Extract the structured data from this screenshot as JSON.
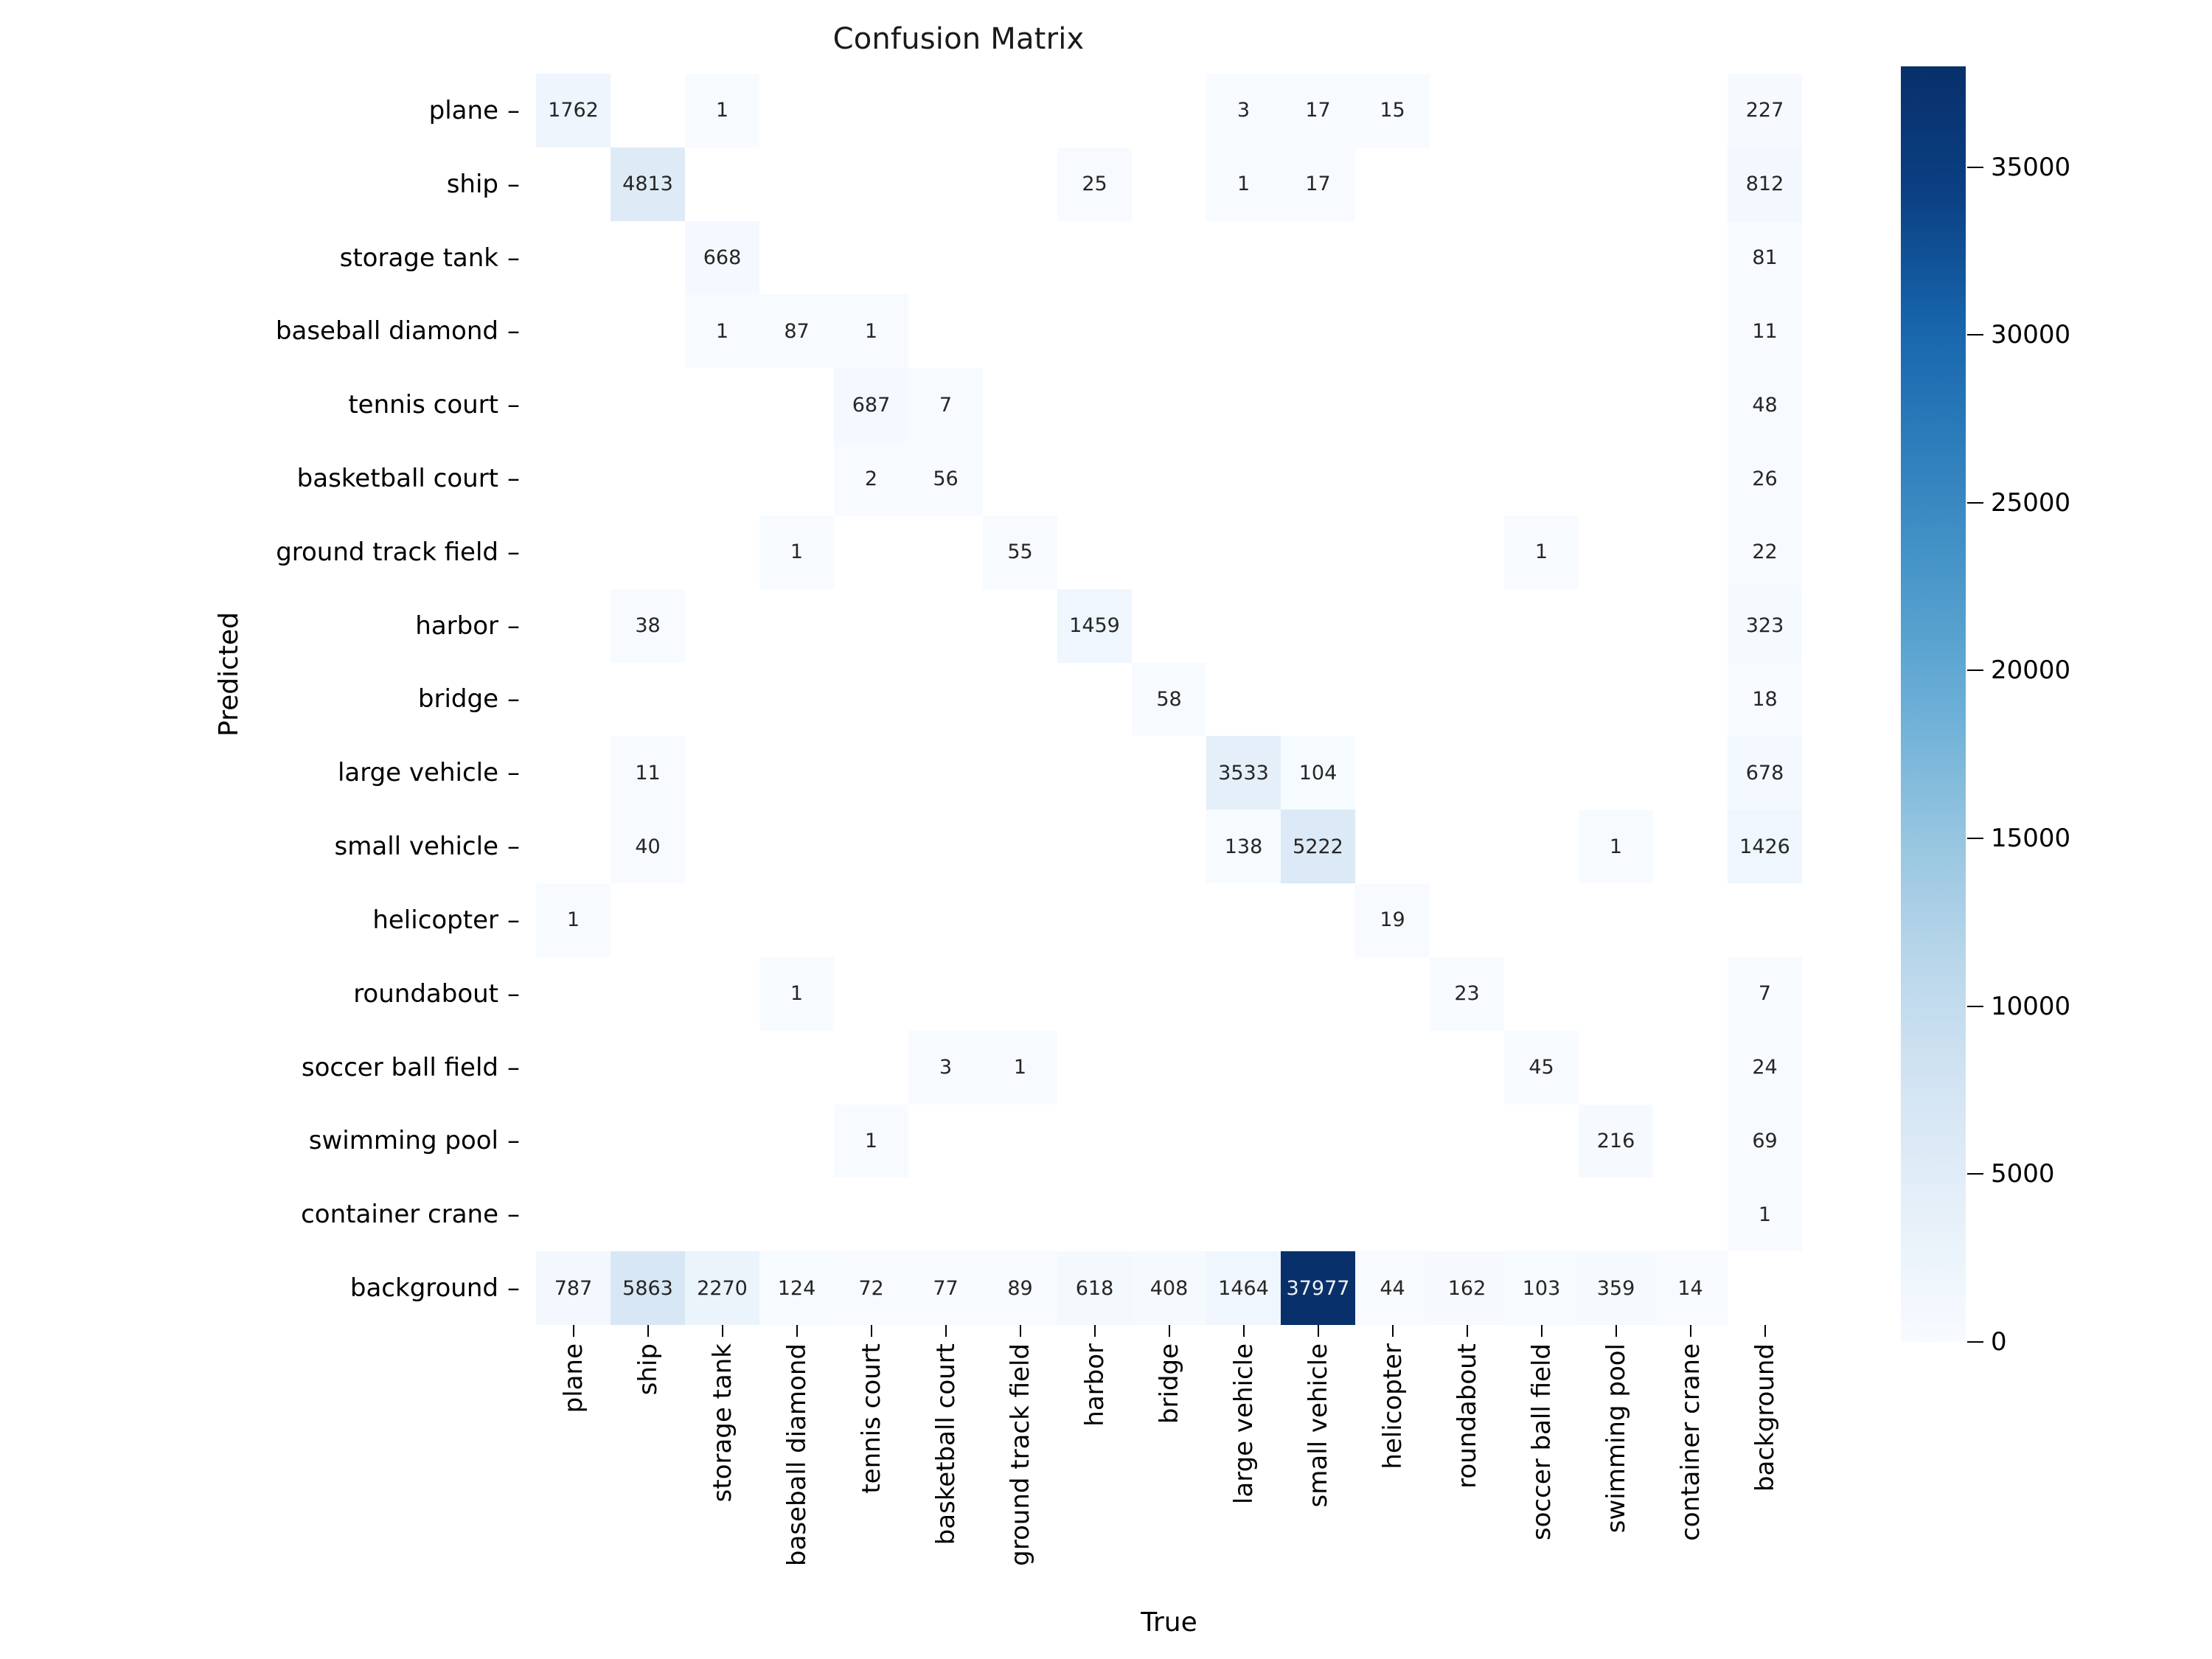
{
  "chart_data": {
    "type": "heatmap",
    "title": "Confusion Matrix",
    "xlabel": "True",
    "ylabel": "Predicted",
    "colormap": "Blues",
    "grid": false,
    "legend_position": "right-colorbar",
    "colorbar": {
      "min": 0,
      "max": 37977,
      "ticks": [
        0,
        5000,
        10000,
        15000,
        20000,
        25000,
        30000,
        35000
      ],
      "tick_labels": [
        "0",
        "5000",
        "10000",
        "15000",
        "20000",
        "25000",
        "30000",
        "35000"
      ],
      "low_color": "#f7fbff",
      "high_color": "#08306b"
    },
    "x_categories": [
      "plane",
      "ship",
      "storage tank",
      "baseball diamond",
      "tennis court",
      "basketball court",
      "ground track field",
      "harbor",
      "bridge",
      "large vehicle",
      "small vehicle",
      "helicopter",
      "roundabout",
      "soccer ball field",
      "swimming pool",
      "container crane",
      "background"
    ],
    "y_categories": [
      "plane",
      "ship",
      "storage tank",
      "baseball diamond",
      "tennis court",
      "basketball court",
      "ground track field",
      "harbor",
      "bridge",
      "large vehicle",
      "small vehicle",
      "helicopter",
      "roundabout",
      "soccer ball field",
      "swimming pool",
      "container crane",
      "background"
    ],
    "values": [
      [
        1762,
        null,
        1,
        null,
        null,
        null,
        null,
        null,
        null,
        3,
        17,
        15,
        null,
        null,
        null,
        null,
        227
      ],
      [
        null,
        4813,
        null,
        null,
        null,
        null,
        null,
        25,
        null,
        1,
        17,
        null,
        null,
        null,
        null,
        null,
        812
      ],
      [
        null,
        null,
        668,
        null,
        null,
        null,
        null,
        null,
        null,
        null,
        null,
        null,
        null,
        null,
        null,
        null,
        81
      ],
      [
        null,
        null,
        1,
        87,
        1,
        null,
        null,
        null,
        null,
        null,
        null,
        null,
        null,
        null,
        null,
        null,
        11
      ],
      [
        null,
        null,
        null,
        null,
        687,
        7,
        null,
        null,
        null,
        null,
        null,
        null,
        null,
        null,
        null,
        null,
        48
      ],
      [
        null,
        null,
        null,
        null,
        2,
        56,
        null,
        null,
        null,
        null,
        null,
        null,
        null,
        null,
        null,
        null,
        26
      ],
      [
        null,
        null,
        null,
        1,
        null,
        null,
        55,
        null,
        null,
        null,
        null,
        null,
        null,
        1,
        null,
        null,
        22
      ],
      [
        null,
        38,
        null,
        null,
        null,
        null,
        null,
        1459,
        null,
        null,
        null,
        null,
        null,
        null,
        null,
        null,
        323
      ],
      [
        null,
        null,
        null,
        null,
        null,
        null,
        null,
        null,
        58,
        null,
        null,
        null,
        null,
        null,
        null,
        null,
        18
      ],
      [
        null,
        11,
        null,
        null,
        null,
        null,
        null,
        null,
        null,
        3533,
        104,
        null,
        null,
        null,
        null,
        null,
        678
      ],
      [
        null,
        40,
        null,
        null,
        null,
        null,
        null,
        null,
        null,
        138,
        5222,
        null,
        null,
        null,
        1,
        null,
        1426
      ],
      [
        1,
        null,
        null,
        null,
        null,
        null,
        null,
        null,
        null,
        null,
        null,
        19,
        null,
        null,
        null,
        null,
        null
      ],
      [
        null,
        null,
        null,
        1,
        null,
        null,
        null,
        null,
        null,
        null,
        null,
        null,
        23,
        null,
        null,
        null,
        7
      ],
      [
        null,
        null,
        null,
        null,
        null,
        3,
        1,
        null,
        null,
        null,
        null,
        null,
        null,
        45,
        null,
        null,
        24
      ],
      [
        null,
        null,
        null,
        null,
        1,
        null,
        null,
        null,
        null,
        null,
        null,
        null,
        null,
        null,
        216,
        null,
        69
      ],
      [
        null,
        null,
        null,
        null,
        null,
        null,
        null,
        null,
        null,
        null,
        null,
        null,
        null,
        null,
        null,
        null,
        1
      ],
      [
        787,
        5863,
        2270,
        124,
        72,
        77,
        89,
        618,
        408,
        1464,
        37977,
        44,
        162,
        103,
        359,
        14,
        null
      ]
    ]
  }
}
